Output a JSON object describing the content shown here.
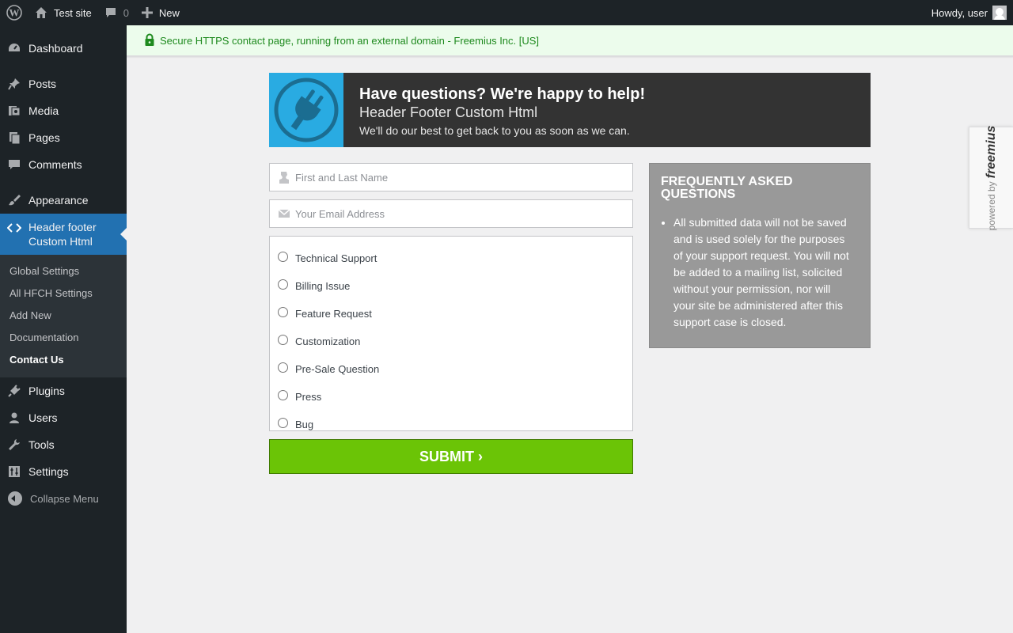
{
  "admin_bar": {
    "site_name": "Test site",
    "comments_count": "0",
    "new_label": "New",
    "greeting": "Howdy, user"
  },
  "sidebar": {
    "items": [
      {
        "label": "Dashboard",
        "icon": "dashboard-icon"
      },
      {
        "label": "Posts",
        "icon": "pin-icon"
      },
      {
        "label": "Media",
        "icon": "media-icon"
      },
      {
        "label": "Pages",
        "icon": "pages-icon"
      },
      {
        "label": "Comments",
        "icon": "comment-icon"
      },
      {
        "label": "Appearance",
        "icon": "brush-icon"
      },
      {
        "label": "Header footer Custom Html",
        "icon": "code-icon"
      },
      {
        "label": "Plugins",
        "icon": "plugin-icon"
      },
      {
        "label": "Users",
        "icon": "user-icon"
      },
      {
        "label": "Tools",
        "icon": "wrench-icon"
      },
      {
        "label": "Settings",
        "icon": "settings-icon"
      }
    ],
    "submenu": [
      "Global Settings",
      "All HFCH Settings",
      "Add New",
      "Documentation",
      "Contact Us"
    ],
    "active_submenu": "Contact Us",
    "collapse_label": "Collapse Menu"
  },
  "notice": {
    "text": "Secure HTTPS contact page, running from an external domain - Freemius Inc. [US]"
  },
  "header_card": {
    "title": "Have questions? We're happy to help!",
    "plugin_name": "Header Footer Custom Html",
    "subtitle": "We'll do our best to get back to you as soon as we can."
  },
  "form": {
    "name_placeholder": "First and Last Name",
    "email_placeholder": "Your Email Address",
    "options": [
      "Technical Support",
      "Billing Issue",
      "Feature Request",
      "Customization",
      "Pre-Sale Question",
      "Press",
      "Bug"
    ],
    "submit_label": "SUBMIT ›"
  },
  "faq": {
    "title": "FREQUENTLY ASKED QUESTIONS",
    "items": [
      "All submitted data will not be saved and is used solely for the purposes of your support request. You will not be added to a mailing list, solicited without your permission, nor will your site be administered after this support case is closed."
    ]
  },
  "powered_by": {
    "prefix": "powered by",
    "brand": "freemius"
  },
  "colors": {
    "admin_dark": "#1d2327",
    "accent_blue": "#2271b1",
    "submit_green": "#6bc406",
    "logo_blue": "#29abe2",
    "notice_text": "#1e8a1e"
  }
}
